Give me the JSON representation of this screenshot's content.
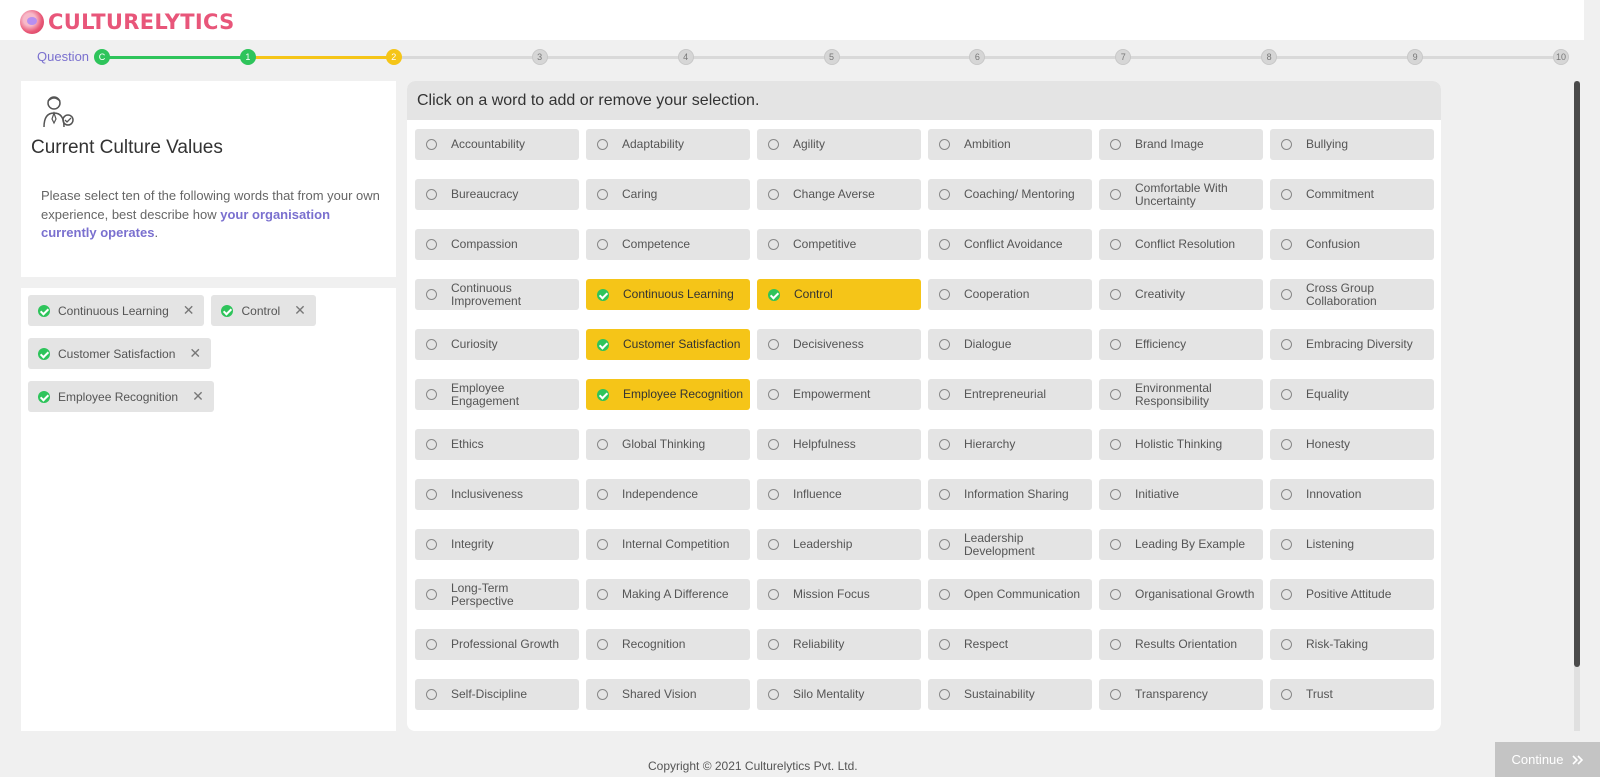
{
  "brand": {
    "name": "CULTURELYTICS",
    "color": "#e8567a"
  },
  "progress": {
    "label": "Question",
    "steps": [
      "C",
      "1",
      "2",
      "3",
      "4",
      "5",
      "6",
      "7",
      "8",
      "9",
      "10"
    ],
    "current_index": 2,
    "colors": {
      "done": "#2ec45b",
      "current": "#f5c518",
      "pending": "#d6d6d6"
    }
  },
  "left": {
    "title": "Current Culture Values",
    "desc_prefix": "Please select ten of the following words that from your own experience, best describe how ",
    "desc_bold": "your organisation currently operates",
    "desc_suffix": ".",
    "selected": [
      "Continuous Learning",
      "Control",
      "Customer Satisfaction",
      "Employee Recognition"
    ]
  },
  "grid": {
    "header": "Click on a word to add or remove your selection.",
    "words": [
      "Accountability",
      "Adaptability",
      "Agility",
      "Ambition",
      "Brand Image",
      "Bullying",
      "Bureaucracy",
      "Caring",
      "Change Averse",
      "Coaching/ Mentoring",
      "Comfortable With Uncertainty",
      "Commitment",
      "Compassion",
      "Competence",
      "Competitive",
      "Conflict Avoidance",
      "Conflict Resolution",
      "Confusion",
      "Continuous Improvement",
      "Continuous Learning",
      "Control",
      "Cooperation",
      "Creativity",
      "Cross Group Collaboration",
      "Curiosity",
      "Customer Satisfaction",
      "Decisiveness",
      "Dialogue",
      "Efficiency",
      "Embracing Diversity",
      "Employee Engagement",
      "Employee Recognition",
      "Empowerment",
      "Entrepreneurial",
      "Environmental Responsibility",
      "Equality",
      "Ethics",
      "Global Thinking",
      "Helpfulness",
      "Hierarchy",
      "Holistic Thinking",
      "Honesty",
      "Inclusiveness",
      "Independence",
      "Influence",
      "Information Sharing",
      "Initiative",
      "Innovation",
      "Integrity",
      "Internal Competition",
      "Leadership",
      "Leadership Development",
      "Leading By Example",
      "Listening",
      "Long-Term Perspective",
      "Making A Difference",
      "Mission Focus",
      "Open Communication",
      "Organisational Growth",
      "Positive Attitude",
      "Professional Growth",
      "Recognition",
      "Reliability",
      "Respect",
      "Results Orientation",
      "Risk-Taking",
      "Self-Discipline",
      "Shared Vision",
      "Silo Mentality",
      "Sustainability",
      "Transparency",
      "Trust"
    ],
    "two_line": [
      "Comfortable With Uncertainty",
      "Continuous Improvement",
      "Cross Group Collaboration",
      "Employee Engagement",
      "Environmental Responsibility",
      "Leadership Development",
      "Long-Term Perspective"
    ],
    "selected_color": "#f5c518"
  },
  "footer": {
    "copyright": "Copyright © 2021 Culturelytics Pvt. Ltd."
  },
  "continue_button": {
    "label": "Continue",
    "icon": "double-chevron-right-icon"
  }
}
